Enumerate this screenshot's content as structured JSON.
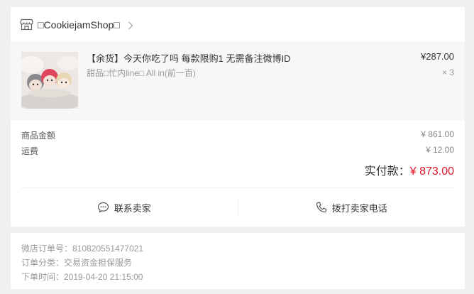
{
  "shop": {
    "name": "□CookiejamShop□"
  },
  "item": {
    "title": "【余货】今天你吃了吗 每款限购1 无需备注微博ID",
    "spec": "甜品□忙内line□ All in(前一百)",
    "price": "¥287.00",
    "quantity": "× 3"
  },
  "summary": {
    "goods_label": "商品金额",
    "goods_value": "¥ 861.00",
    "shipping_label": "运费",
    "shipping_value": "¥ 12.00",
    "paid_label": "实付款：",
    "paid_value": "¥ 873.00"
  },
  "actions": {
    "contact_seller": "联系卖家",
    "call_seller": "拨打卖家电话"
  },
  "order_meta": {
    "order_number": "微店订单号：810820551477021",
    "order_type": "订单分类：交易资金担保服务",
    "order_time": "下单时间：2019-04-20 21:15:00"
  },
  "icons": {
    "shop": "shop-icon",
    "chevron": "chevron-right-icon",
    "chat": "chat-icon",
    "phone": "phone-icon"
  },
  "colors": {
    "paid_amount": "#e0162b",
    "background": "#f0f0f0"
  }
}
